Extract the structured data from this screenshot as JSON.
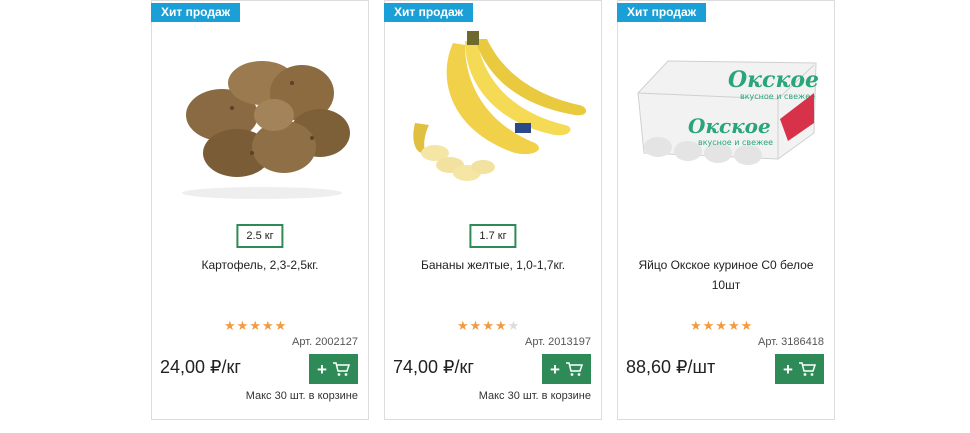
{
  "products": [
    {
      "badge": "Хит продаж",
      "weight": "2.5 кг",
      "title": "Картофель, 2,3-2,5кг.",
      "rating": 5,
      "article": "Арт. 2002127",
      "price": "24,00 ₽/кг",
      "max_note": "Макс 30 шт. в корзине"
    },
    {
      "badge": "Хит продаж",
      "weight": "1.7 кг",
      "title": "Бананы желтые, 1,0-1,7кг.",
      "rating": 4,
      "article": "Арт. 2013197",
      "price": "74,00 ₽/кг",
      "max_note": "Макс 30 шт. в корзине"
    },
    {
      "badge": "Хит продаж",
      "title": "Яйцо Окское куриное С0 белое 10шт",
      "rating": 5,
      "article": "Арт. 3186418",
      "price": "88,60 ₽/шт",
      "egg_brand": "Окское",
      "egg_slogan": "вкусное и свежее"
    }
  ],
  "colors": {
    "badge": "#1aa0d6",
    "button": "#2e8b57",
    "star": "#f39a3e",
    "star_off": "#dcdcdc"
  },
  "icons": {
    "cart": "cart-icon",
    "plus": "plus-icon",
    "star": "star-icon"
  }
}
